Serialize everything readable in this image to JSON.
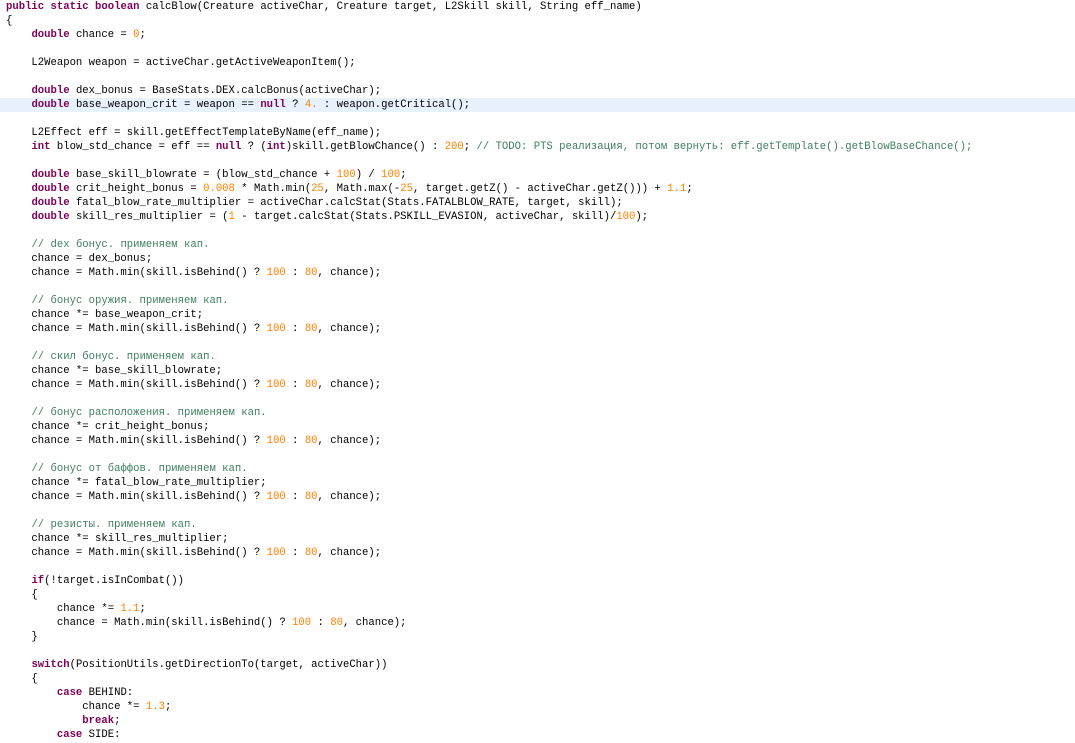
{
  "editor": {
    "highlighted_line": 7,
    "colors": {
      "background": "#ffffff",
      "current_line": "#e8f2fe",
      "keyword": "#7f0055",
      "number": "#ff8000",
      "comment": "#3f7f5f",
      "text": "#000000"
    },
    "lines": [
      [
        [
          "k",
          "public"
        ],
        [
          "p",
          " "
        ],
        [
          "k",
          "static"
        ],
        [
          "p",
          " "
        ],
        [
          "k",
          "boolean"
        ],
        [
          "p",
          " calcBlow(Creature activeChar, Creature target, L2Skill skill, String eff_name)"
        ]
      ],
      [
        [
          "p",
          "{"
        ]
      ],
      [
        [
          "p",
          "    "
        ],
        [
          "k",
          "double"
        ],
        [
          "p",
          " chance = "
        ],
        [
          "n",
          "0"
        ],
        [
          "p",
          ";"
        ]
      ],
      [],
      [
        [
          "p",
          "    L2Weapon weapon = activeChar.getActiveWeaponItem();"
        ]
      ],
      [],
      [
        [
          "p",
          "    "
        ],
        [
          "k",
          "double"
        ],
        [
          "p",
          " dex_bonus = BaseStats.DEX.calcBonus(activeChar);"
        ]
      ],
      [
        [
          "p",
          "    "
        ],
        [
          "k",
          "double"
        ],
        [
          "p",
          " base_weapon_crit = weapon == "
        ],
        [
          "k",
          "null"
        ],
        [
          "p",
          " ? "
        ],
        [
          "n",
          "4."
        ],
        [
          "p",
          " : weapon.getCritical();"
        ]
      ],
      [],
      [
        [
          "p",
          "    L2Effect eff = skill.getEffectTemplateByName(eff_name);"
        ]
      ],
      [
        [
          "p",
          "    "
        ],
        [
          "k",
          "int"
        ],
        [
          "p",
          " blow_std_chance = eff == "
        ],
        [
          "k",
          "null"
        ],
        [
          "p",
          " ? ("
        ],
        [
          "k",
          "int"
        ],
        [
          "p",
          ")skill.getBlowChance() : "
        ],
        [
          "n",
          "200"
        ],
        [
          "p",
          "; "
        ],
        [
          "c",
          "// TODO: PTS реализация, потом вернуть: eff.getTemplate().getBlowBaseChance();"
        ]
      ],
      [],
      [
        [
          "p",
          "    "
        ],
        [
          "k",
          "double"
        ],
        [
          "p",
          " base_skill_blowrate = (blow_std_chance + "
        ],
        [
          "n",
          "100"
        ],
        [
          "p",
          ") / "
        ],
        [
          "n",
          "100"
        ],
        [
          "p",
          ";"
        ]
      ],
      [
        [
          "p",
          "    "
        ],
        [
          "k",
          "double"
        ],
        [
          "p",
          " crit_height_bonus = "
        ],
        [
          "n",
          "0.008"
        ],
        [
          "p",
          " * Math.min("
        ],
        [
          "n",
          "25"
        ],
        [
          "p",
          ", Math.max(-"
        ],
        [
          "n",
          "25"
        ],
        [
          "p",
          ", target.getZ() - activeChar.getZ())) + "
        ],
        [
          "n",
          "1.1"
        ],
        [
          "p",
          ";"
        ]
      ],
      [
        [
          "p",
          "    "
        ],
        [
          "k",
          "double"
        ],
        [
          "p",
          " fatal_blow_rate_multiplier = activeChar.calcStat(Stats.FATALBLOW_RATE, target, skill);"
        ]
      ],
      [
        [
          "p",
          "    "
        ],
        [
          "k",
          "double"
        ],
        [
          "p",
          " skill_res_multiplier = ("
        ],
        [
          "n",
          "1"
        ],
        [
          "p",
          " - target.calcStat(Stats.PSKILL_EVASION, activeChar, skill)/"
        ],
        [
          "n",
          "100"
        ],
        [
          "p",
          ");"
        ]
      ],
      [],
      [
        [
          "p",
          "    "
        ],
        [
          "c",
          "// dex бонус. применяем кап."
        ]
      ],
      [
        [
          "p",
          "    chance = dex_bonus;"
        ]
      ],
      [
        [
          "p",
          "    chance = Math.min(skill.isBehind() ? "
        ],
        [
          "n",
          "100"
        ],
        [
          "p",
          " : "
        ],
        [
          "n",
          "80"
        ],
        [
          "p",
          ", chance);"
        ]
      ],
      [],
      [
        [
          "p",
          "    "
        ],
        [
          "c",
          "// бонус оружия. применяем кап."
        ]
      ],
      [
        [
          "p",
          "    chance *= base_weapon_crit;"
        ]
      ],
      [
        [
          "p",
          "    chance = Math.min(skill.isBehind() ? "
        ],
        [
          "n",
          "100"
        ],
        [
          "p",
          " : "
        ],
        [
          "n",
          "80"
        ],
        [
          "p",
          ", chance);"
        ]
      ],
      [],
      [
        [
          "p",
          "    "
        ],
        [
          "c",
          "// скил бонус. применяем кап."
        ]
      ],
      [
        [
          "p",
          "    chance *= base_skill_blowrate;"
        ]
      ],
      [
        [
          "p",
          "    chance = Math.min(skill.isBehind() ? "
        ],
        [
          "n",
          "100"
        ],
        [
          "p",
          " : "
        ],
        [
          "n",
          "80"
        ],
        [
          "p",
          ", chance);"
        ]
      ],
      [],
      [
        [
          "p",
          "    "
        ],
        [
          "c",
          "// бонус расположения. применяем кап."
        ]
      ],
      [
        [
          "p",
          "    chance *= crit_height_bonus;"
        ]
      ],
      [
        [
          "p",
          "    chance = Math.min(skill.isBehind() ? "
        ],
        [
          "n",
          "100"
        ],
        [
          "p",
          " : "
        ],
        [
          "n",
          "80"
        ],
        [
          "p",
          ", chance);"
        ]
      ],
      [],
      [
        [
          "p",
          "    "
        ],
        [
          "c",
          "// бонус от баффов. применяем кап."
        ]
      ],
      [
        [
          "p",
          "    chance *= fatal_blow_rate_multiplier;"
        ]
      ],
      [
        [
          "p",
          "    chance = Math.min(skill.isBehind() ? "
        ],
        [
          "n",
          "100"
        ],
        [
          "p",
          " : "
        ],
        [
          "n",
          "80"
        ],
        [
          "p",
          ", chance);"
        ]
      ],
      [],
      [
        [
          "p",
          "    "
        ],
        [
          "c",
          "// резисты. применяем кап."
        ]
      ],
      [
        [
          "p",
          "    chance *= skill_res_multiplier;"
        ]
      ],
      [
        [
          "p",
          "    chance = Math.min(skill.isBehind() ? "
        ],
        [
          "n",
          "100"
        ],
        [
          "p",
          " : "
        ],
        [
          "n",
          "80"
        ],
        [
          "p",
          ", chance);"
        ]
      ],
      [],
      [
        [
          "p",
          "    "
        ],
        [
          "k",
          "if"
        ],
        [
          "p",
          "(!target.isInCombat())"
        ]
      ],
      [
        [
          "p",
          "    {"
        ]
      ],
      [
        [
          "p",
          "        chance *= "
        ],
        [
          "n",
          "1.1"
        ],
        [
          "p",
          ";"
        ]
      ],
      [
        [
          "p",
          "        chance = Math.min(skill.isBehind() ? "
        ],
        [
          "n",
          "100"
        ],
        [
          "p",
          " : "
        ],
        [
          "n",
          "80"
        ],
        [
          "p",
          ", chance);"
        ]
      ],
      [
        [
          "p",
          "    }"
        ]
      ],
      [],
      [
        [
          "p",
          "    "
        ],
        [
          "k",
          "switch"
        ],
        [
          "p",
          "(PositionUtils.getDirectionTo(target, activeChar))"
        ]
      ],
      [
        [
          "p",
          "    {"
        ]
      ],
      [
        [
          "p",
          "        "
        ],
        [
          "k",
          "case"
        ],
        [
          "p",
          " BEHIND:"
        ]
      ],
      [
        [
          "p",
          "            chance *= "
        ],
        [
          "n",
          "1.3"
        ],
        [
          "p",
          ";"
        ]
      ],
      [
        [
          "p",
          "            "
        ],
        [
          "k",
          "break"
        ],
        [
          "p",
          ";"
        ]
      ],
      [
        [
          "p",
          "        "
        ],
        [
          "k",
          "case"
        ],
        [
          "p",
          " SIDE:"
        ]
      ]
    ]
  }
}
